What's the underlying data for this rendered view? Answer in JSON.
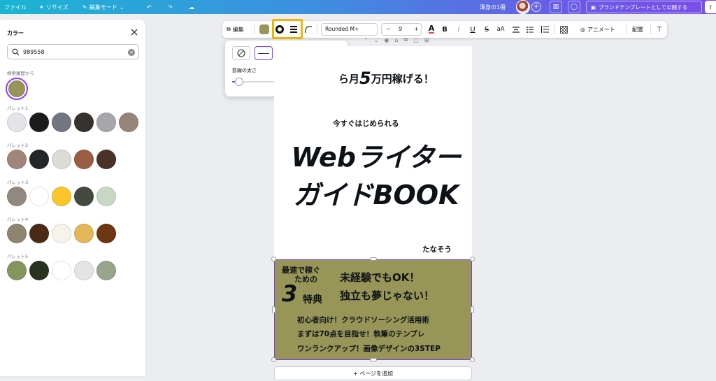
{
  "topbar": {
    "file_label": "ファイル",
    "resize_label": "リサイズ",
    "edit_mode_label": "編集モード",
    "doc_title": "渾身の1冊",
    "add_label": "+",
    "brand_template_label": "ブランドテンプレートとして公開する"
  },
  "color_panel": {
    "title": "カラー",
    "search_value": "989558",
    "history_label": "検索履歴から",
    "history_colors": [
      "#989558"
    ],
    "palettes": [
      {
        "label": "パレット1",
        "colors": [
          "#e3e4e7",
          "#1c1c1c",
          "#727680",
          "#36322f",
          "#a6a6ab",
          "#968479"
        ]
      },
      {
        "label": "パレット2",
        "colors": [
          "#a08578",
          "#24262a",
          "#dddcd4",
          "#9a5d44",
          "#4b3228"
        ]
      },
      {
        "label": "パレット3",
        "colors": [
          "#918880",
          "#ffffff",
          "#fcc52c",
          "#444a40",
          "#c9d8c4"
        ]
      },
      {
        "label": "パレット4",
        "colors": [
          "#8e8470",
          "#4a2c16",
          "#f6f3ea",
          "#e4b858",
          "#6c3712"
        ]
      },
      {
        "label": "パレット5",
        "colors": [
          "#84965f",
          "#2a3320",
          "#ffffff",
          "#e3e5e3",
          "#97a58c"
        ]
      }
    ]
  },
  "toolbar": {
    "edit_label": "編集",
    "fill_color": "#989558",
    "font_name": "Rounded M+",
    "font_size": "9",
    "minus": "−",
    "plus": "+",
    "bold": "B",
    "italic": "I",
    "underline": "U",
    "strike": "S",
    "case": "aA",
    "animate_label": "アニメート",
    "position_label": "配置"
  },
  "border_dropdown": {
    "weight_label": "罫線の太さ",
    "weight_value": "4",
    "weight_fraction": 0.08
  },
  "page": {
    "line1_prefix": "ら月",
    "line1_num": "5",
    "line1_suffix": "万円稼げる！",
    "subtitle": "今すぐはじめられる",
    "title_line1": "Webライター",
    "title_line2": "ガイドBOOK",
    "author": "たなそう",
    "box_fill": "#989558",
    "box": {
      "head1": "最速で稼ぐ",
      "head2": "ための",
      "num": "3",
      "tokuten": "特典",
      "main1": "未経験でもOK！",
      "main2": "独立も夢じゃない！",
      "list": [
        "初心者向け！クラウドソーシング活用術",
        "まずは70点を目指せ！執筆のテンプレ",
        "ワンランクアップ！画像デザインの3STEP"
      ]
    }
  },
  "add_page_label": "+ ページを追加"
}
